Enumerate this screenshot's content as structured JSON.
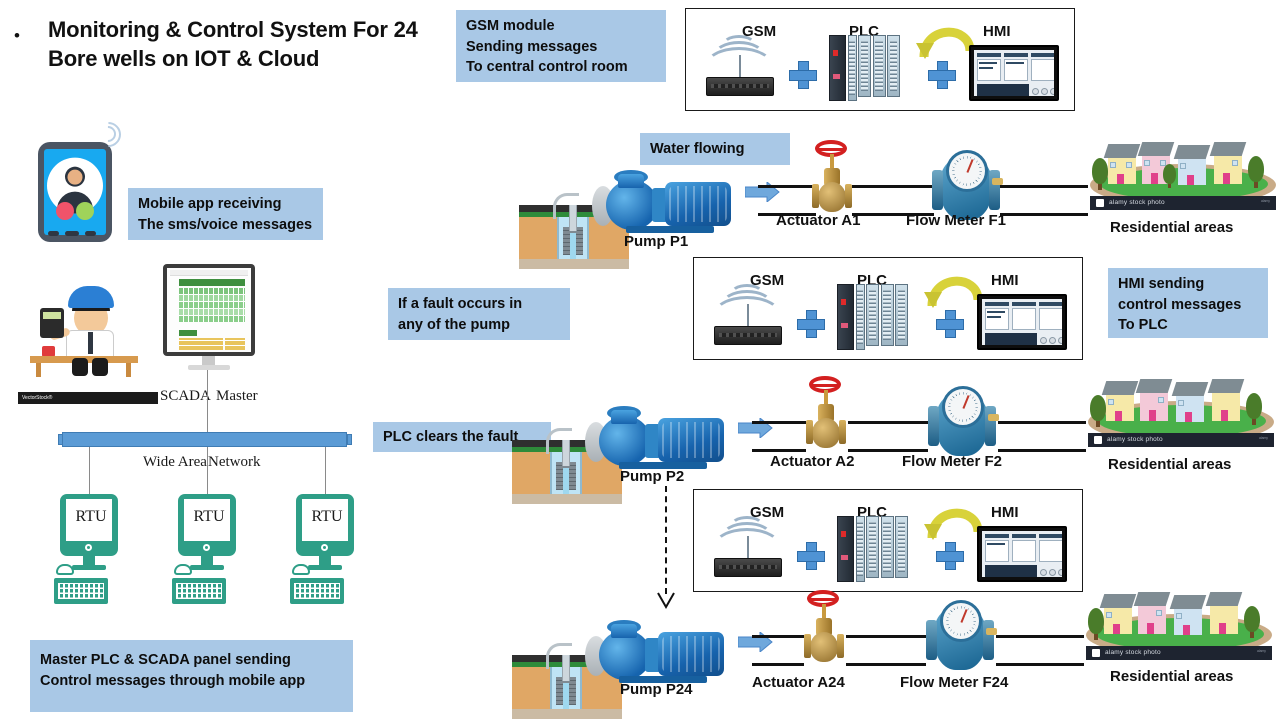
{
  "title": {
    "bullet": "•",
    "text": "Monitoring & Control System For 24 Bore wells on IOT & Cloud"
  },
  "captions": {
    "gsm_module": "GSM module\nSending messages\nTo central control room",
    "mobile_app": "Mobile app receiving\nThe sms/voice messages",
    "water_flowing": "Water flowing",
    "fault_occurs": "If a fault occurs in\nany of the pump",
    "hmi_sending": "HMI sending\n control messages\nTo PLC",
    "plc_clears": "PLC clears the fault",
    "master_plc": "Master PLC & SCADA panel sending\nControl messages through mobile app"
  },
  "modules": [
    {
      "gsm": "GSM",
      "plc": "PLC",
      "hmi": "HMI",
      "plus1": "+",
      "plus2": "+"
    },
    {
      "gsm": "GSM",
      "plc": "PLC",
      "hmi": "HMI",
      "plus1": "+",
      "plus2": "+"
    },
    {
      "gsm": "GSM",
      "plc": "PLC",
      "hmi": "HMI",
      "plus1": "+",
      "plus2": "+"
    }
  ],
  "scada": {
    "label_left": "SCADA",
    "label_right": "Master",
    "wan_left": "Wide Area",
    "wan_right": "Network",
    "vectorstock_watermark": "VectorStock®",
    "rtus": [
      {
        "label": "RTU"
      },
      {
        "label": "RTU"
      },
      {
        "label": "RTU"
      }
    ]
  },
  "pump_rows": [
    {
      "pump": "Pump P1",
      "actuator": "Actuator A1",
      "flow_meter": "Flow Meter F1",
      "residential": "Residential areas",
      "watermark": "alamy stock photo"
    },
    {
      "pump": "Pump P2",
      "actuator": "Actuator A2",
      "flow_meter": "Flow Meter F2",
      "residential": "Residential areas",
      "watermark": "alamy stock photo"
    },
    {
      "pump": "Pump P24",
      "actuator": "Actuator A24",
      "flow_meter": "Flow Meter F24",
      "residential": "Residential areas",
      "watermark": "alamy stock photo"
    }
  ],
  "colors": {
    "caption_bg": "#a9c8e6",
    "wan_bar": "#5b9bd5",
    "rtu_green": "#2e9e87",
    "pump_blue": "#1763ad",
    "valve_red": "#d32020",
    "plus_blue": "#4f93d4",
    "arrow_yellow": "#d8d23a",
    "text": "#111111"
  }
}
